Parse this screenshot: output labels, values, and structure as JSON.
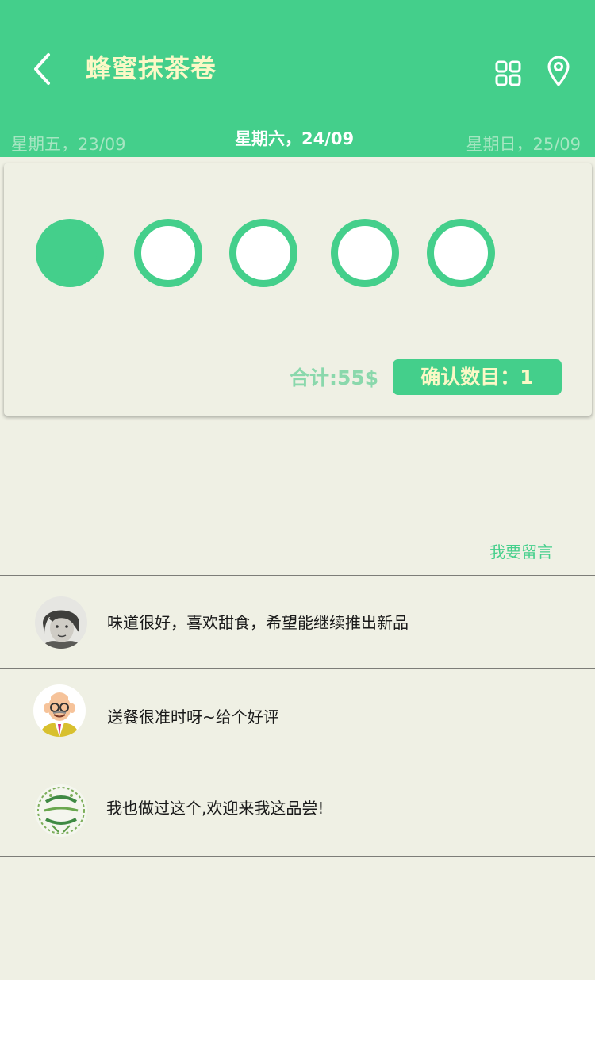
{
  "header": {
    "title": "蜂蜜抹茶卷",
    "back_icon": "chevron-left-icon",
    "grid_icon": "grid-icon",
    "location_icon": "location-pin-icon",
    "accent_color": "#44cf8b",
    "title_color": "#fbf8c6"
  },
  "dates": {
    "prev": "星期五，23/09",
    "current": "星期六，24/09",
    "next": "星期日，25/09"
  },
  "selector": {
    "selected_count": 1,
    "total_options": 5
  },
  "order": {
    "total": "合计:55$",
    "confirm": "确认数目：1"
  },
  "comments_section": {
    "leave_message": "我要留言",
    "items": [
      {
        "avatar": "avatar-woman-sketch",
        "text": "味道很好，喜欢甜食，希望能继续推出新品"
      },
      {
        "avatar": "avatar-cartoon-old-man",
        "text": "送餐很准时呀~给个好评"
      },
      {
        "avatar": "avatar-green-emblem",
        "text": "我也做过这个,欢迎来我这品尝!"
      }
    ]
  }
}
